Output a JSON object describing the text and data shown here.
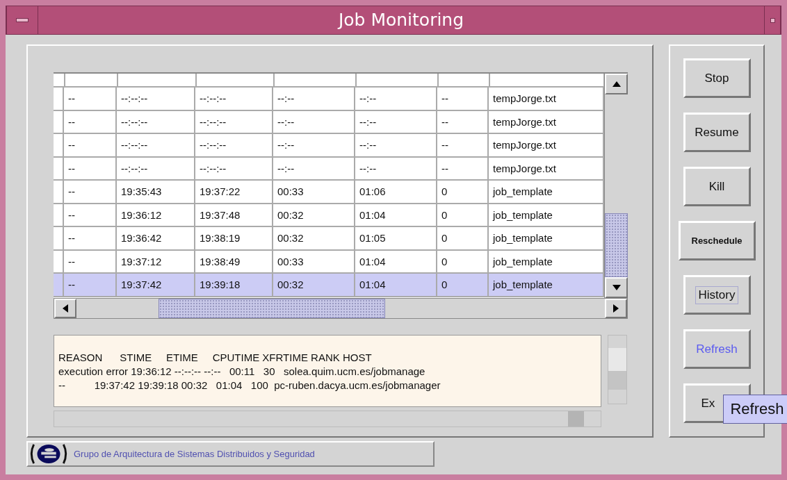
{
  "window": {
    "title": "Job Monitoring"
  },
  "table": {
    "rows": [
      {
        "cells": [
          "--",
          "--:--:--",
          "--:--:--",
          "--:--",
          "--:--",
          "--",
          "tempJorge.txt"
        ],
        "selected": false
      },
      {
        "cells": [
          "--",
          "--:--:--",
          "--:--:--",
          "--:--",
          "--:--",
          "--",
          "tempJorge.txt"
        ],
        "selected": false
      },
      {
        "cells": [
          "--",
          "--:--:--",
          "--:--:--",
          "--:--",
          "--:--",
          "--",
          "tempJorge.txt"
        ],
        "selected": false
      },
      {
        "cells": [
          "--",
          "--:--:--",
          "--:--:--",
          "--:--",
          "--:--",
          "--",
          "tempJorge.txt"
        ],
        "selected": false
      },
      {
        "cells": [
          "--",
          "19:35:43",
          "19:37:22",
          "00:33",
          "01:06",
          "0",
          "job_template"
        ],
        "selected": false
      },
      {
        "cells": [
          "--",
          "19:36:12",
          "19:37:48",
          "00:32",
          "01:04",
          "0",
          "job_template"
        ],
        "selected": false
      },
      {
        "cells": [
          "--",
          "19:36:42",
          "19:38:19",
          "00:32",
          "01:05",
          "0",
          "job_template"
        ],
        "selected": false
      },
      {
        "cells": [
          "--",
          "19:37:12",
          "19:38:49",
          "00:33",
          "01:04",
          "0",
          "job_template"
        ],
        "selected": false
      },
      {
        "cells": [
          "--",
          "19:37:42",
          "19:39:18",
          "00:32",
          "01:04",
          "0",
          "job_template"
        ],
        "selected": true
      }
    ]
  },
  "log": {
    "lines": [
      "REASON      STIME     ETIME     CPUTIME XFRTIME RANK HOST",
      "execution error 19:36:12 --:--:-- --:--   00:11   30   solea.quim.ucm.es/jobmanage",
      "--          19:37:42 19:39:18 00:32   01:04   100  pc-ruben.dacya.ucm.es/jobmanager"
    ]
  },
  "buttons": [
    {
      "label": "Stop",
      "kind": "normal",
      "hovered": false,
      "focused": false
    },
    {
      "label": "Resume",
      "kind": "normal",
      "hovered": false,
      "focused": false
    },
    {
      "label": "Kill",
      "kind": "normal",
      "hovered": false,
      "focused": false
    },
    {
      "label": "Reschedule",
      "kind": "wide",
      "hovered": false,
      "focused": false
    },
    {
      "label": "History",
      "kind": "normal",
      "hovered": false,
      "focused": true
    },
    {
      "label": "Refresh",
      "kind": "normal",
      "hovered": true,
      "focused": false
    },
    {
      "label": "Ex",
      "kind": "covered",
      "hovered": false,
      "focused": false
    }
  ],
  "tooltip": {
    "text": "Refresh"
  },
  "status_bar": {
    "text": "Grupo de Arquitectura de Sistemas Distribuidos y Seguridad"
  }
}
